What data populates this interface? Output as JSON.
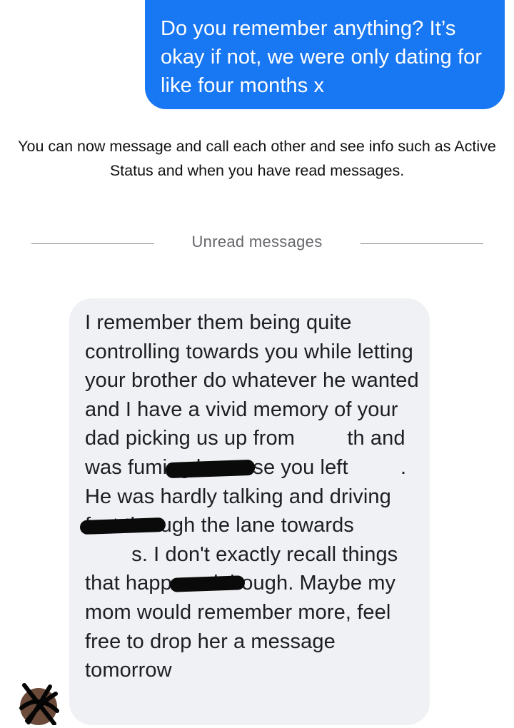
{
  "sent_message": {
    "text": "Do you remember anything? It’s okay if not, we were only dating for like four months x"
  },
  "system_note": {
    "text": "You can now message and call each other and see info such as Active Status and when you have read messages."
  },
  "divider": {
    "label": "Unread messages"
  },
  "received_message": {
    "text": "I remember them being quite controlling towards you while letting your brother do whatever he wanted and I have a vivid memory of your dad picking us up from [redacted]th and was fuming because you left [redacted]. He was hardly talking and driving fast through the lane towards [redacted]s. I don't exactly recall things that happened though. Maybe my mom would remember more, feel free to drop her a message tomorrow"
  },
  "colors": {
    "sent_bubble": "#1877f2",
    "received_bubble": "#eff1f4",
    "divider_text": "#65676b"
  },
  "avatar": {
    "icon": "scribbled-avatar-icon"
  }
}
